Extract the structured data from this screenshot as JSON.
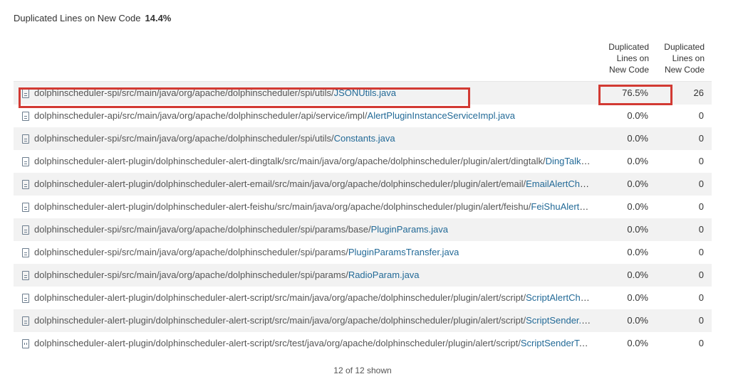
{
  "metric": {
    "label": "Duplicated Lines on New Code",
    "value": "14.4%"
  },
  "columns": {
    "pct_header": "Duplicated Lines on New Code",
    "pct_header_lines": [
      "Duplicated",
      "Lines on",
      "New Code"
    ],
    "count_header_lines": [
      "Duplicated",
      "Lines on",
      "New Code"
    ]
  },
  "files": [
    {
      "path": "dolphinscheduler-spi/src/main/java/org/apache/dolphinscheduler/spi/utils/",
      "name": "JSONUtils.java",
      "pct": "76.5%",
      "count": "26",
      "icon": "file-icon"
    },
    {
      "path": "dolphinscheduler-api/src/main/java/org/apache/dolphinscheduler/api/service/impl/",
      "name": "AlertPluginInstanceServiceImpl.java",
      "pct": "0.0%",
      "count": "0",
      "icon": "file-icon"
    },
    {
      "path": "dolphinscheduler-spi/src/main/java/org/apache/dolphinscheduler/spi/utils/",
      "name": "Constants.java",
      "pct": "0.0%",
      "count": "0",
      "icon": "file-icon"
    },
    {
      "path": "dolphinscheduler-alert-plugin/dolphinscheduler-alert-dingtalk/src/main/java/org/apache/dolphinscheduler/plugin/alert/dingtalk/",
      "name": "DingTalkAlertC…",
      "pct": "0.0%",
      "count": "0",
      "icon": "file-icon"
    },
    {
      "path": "dolphinscheduler-alert-plugin/dolphinscheduler-alert-email/src/main/java/org/apache/dolphinscheduler/plugin/alert/email/",
      "name": "EmailAlertChannelF…",
      "pct": "0.0%",
      "count": "0",
      "icon": "file-icon"
    },
    {
      "path": "dolphinscheduler-alert-plugin/dolphinscheduler-alert-feishu/src/main/java/org/apache/dolphinscheduler/plugin/alert/feishu/",
      "name": "FeiShuAlertChanne…",
      "pct": "0.0%",
      "count": "0",
      "icon": "file-icon"
    },
    {
      "path": "dolphinscheduler-spi/src/main/java/org/apache/dolphinscheduler/spi/params/base/",
      "name": "PluginParams.java",
      "pct": "0.0%",
      "count": "0",
      "icon": "file-icon"
    },
    {
      "path": "dolphinscheduler-spi/src/main/java/org/apache/dolphinscheduler/spi/params/",
      "name": "PluginParamsTransfer.java",
      "pct": "0.0%",
      "count": "0",
      "icon": "file-icon"
    },
    {
      "path": "dolphinscheduler-spi/src/main/java/org/apache/dolphinscheduler/spi/params/",
      "name": "RadioParam.java",
      "pct": "0.0%",
      "count": "0",
      "icon": "file-icon"
    },
    {
      "path": "dolphinscheduler-alert-plugin/dolphinscheduler-alert-script/src/main/java/org/apache/dolphinscheduler/plugin/alert/script/",
      "name": "ScriptAlertChannelF…",
      "pct": "0.0%",
      "count": "0",
      "icon": "file-icon"
    },
    {
      "path": "dolphinscheduler-alert-plugin/dolphinscheduler-alert-script/src/main/java/org/apache/dolphinscheduler/plugin/alert/script/",
      "name": "ScriptSender.java",
      "pct": "0.0%",
      "count": "0",
      "icon": "file-icon"
    },
    {
      "path": "dolphinscheduler-alert-plugin/dolphinscheduler-alert-script/src/test/java/org/apache/dolphinscheduler/plugin/alert/script/",
      "name": "ScriptSenderTest.java",
      "pct": "0.0%",
      "count": "0",
      "icon": "test-file-icon"
    }
  ],
  "footer": {
    "shown_text": "12 of 12 shown"
  },
  "colors": {
    "link": "#236a97",
    "highlight": "#d23a33",
    "stripe": "#f2f2f2"
  }
}
